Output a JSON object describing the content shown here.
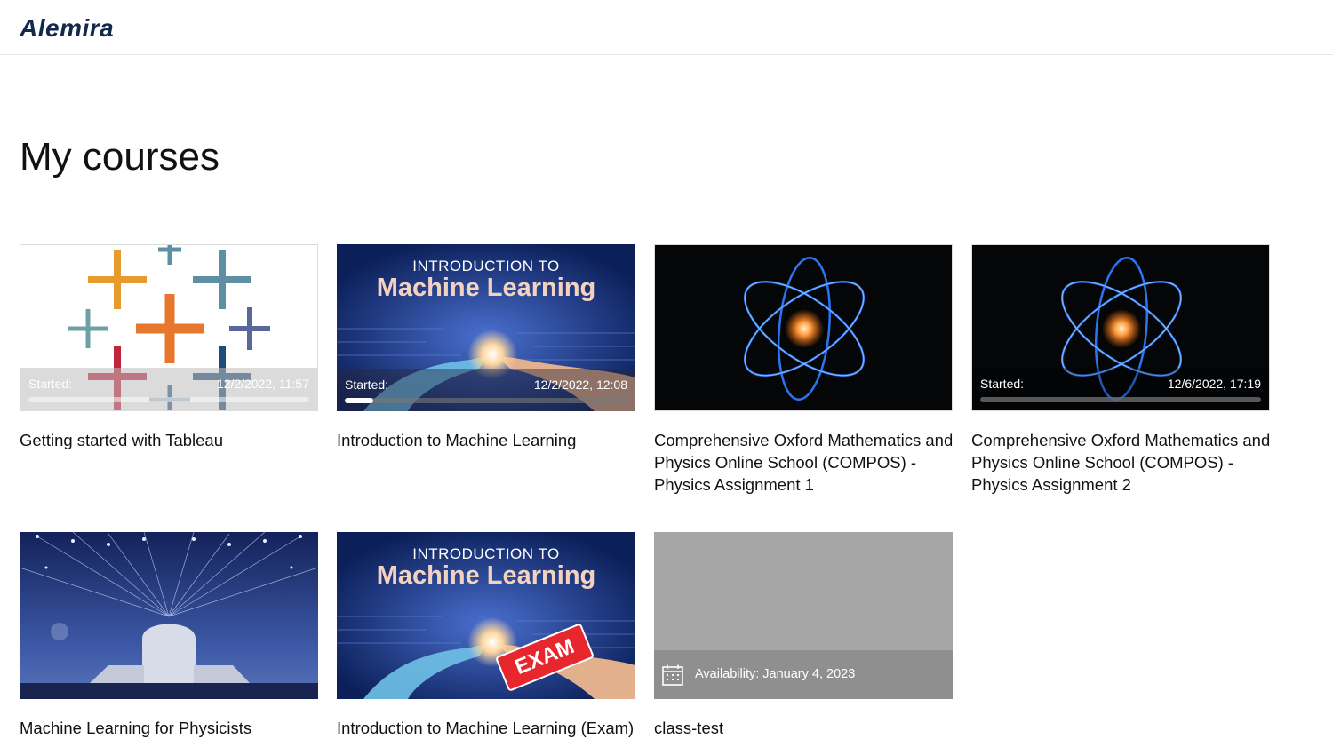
{
  "app": {
    "logo": "Alemira"
  },
  "page": {
    "title": "My courses"
  },
  "courses": [
    {
      "title": "Getting started with Tableau",
      "status_label": "Started:",
      "date": "12/2/2022, 11:57",
      "progress": 0
    },
    {
      "title": "Introduction to Machine Learning",
      "status_label": "Started:",
      "date": "12/2/2022, 12:08",
      "progress": 0.1,
      "thumb_line1": "INTRODUCTION TO",
      "thumb_line2": "Machine Learning"
    },
    {
      "title": "Comprehensive Oxford Mathematics and Physics Online School (COMPOS) - Physics Assignment 1"
    },
    {
      "title": "Comprehensive Oxford Mathematics and Physics Online School (COMPOS) - Physics Assignment 2",
      "status_label": "Started:",
      "date": "12/6/2022, 17:19",
      "progress": 0
    },
    {
      "title": "Machine Learning for Physicists"
    },
    {
      "title": "Introduction to Machine Learning (Exam)",
      "thumb_line1": "INTRODUCTION TO",
      "thumb_line2": "Machine Learning",
      "stamp": "EXAM"
    },
    {
      "title": "class-test",
      "availability": "Availability: January 4, 2023"
    }
  ],
  "icons": {
    "course1": "tableau-logo-icon",
    "course2": "robot-hand-icon",
    "course3": "atom-icon",
    "course4": "atom-icon",
    "course5": "ai-head-icon",
    "course6": "robot-hand-icon",
    "course7_calendar": "calendar-icon"
  },
  "colors": {
    "logo": "#13294b",
    "ml_blue": "#0e2a6e",
    "atom_glow": "#2f7bff",
    "placeholder_gray": "#a6a6a6"
  }
}
